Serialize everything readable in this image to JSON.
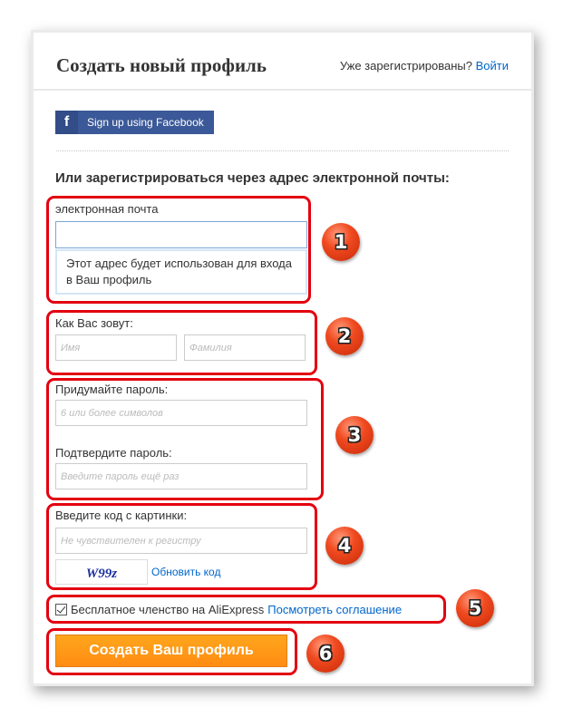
{
  "header": {
    "title": "Создать новый профиль",
    "already_registered": "Уже зарегистрированы?",
    "login_link": "Войти"
  },
  "facebook": {
    "icon": "facebook-icon",
    "icon_glyph": "f",
    "label": "Sign up using Facebook"
  },
  "email_section": {
    "heading": "Или зарегистрироваться через адрес электронной почты:",
    "email_label": "электронная почта",
    "email_value": "",
    "email_hint": "Этот адрес будет использован для входа в Ваш профиль"
  },
  "name_section": {
    "label": "Как Вас зовут:",
    "first_name_placeholder": "Имя",
    "last_name_placeholder": "Фамилия"
  },
  "password_section": {
    "password_label": "Придумайте пароль:",
    "password_placeholder": "6 или более символов",
    "confirm_label": "Подтвердите пароль:",
    "confirm_placeholder": "Введите пароль ещё раз"
  },
  "captcha_section": {
    "label": "Введите код с картинки:",
    "input_placeholder": "Не чувствителен к регистру",
    "captcha_text": "W99z",
    "refresh_link": "Обновить код"
  },
  "agreement": {
    "checked": true,
    "text": "Бесплатное членство на AliExpress",
    "link": "Посмотреть соглашение"
  },
  "submit": {
    "label": "Создать Ваш профиль"
  },
  "annotations": {
    "color": "#e3000f",
    "badges": [
      "1",
      "2",
      "3",
      "4",
      "5",
      "6"
    ]
  },
  "colors": {
    "facebook": "#3b5998",
    "link": "#0066cc",
    "submit": "#ff9a17"
  }
}
